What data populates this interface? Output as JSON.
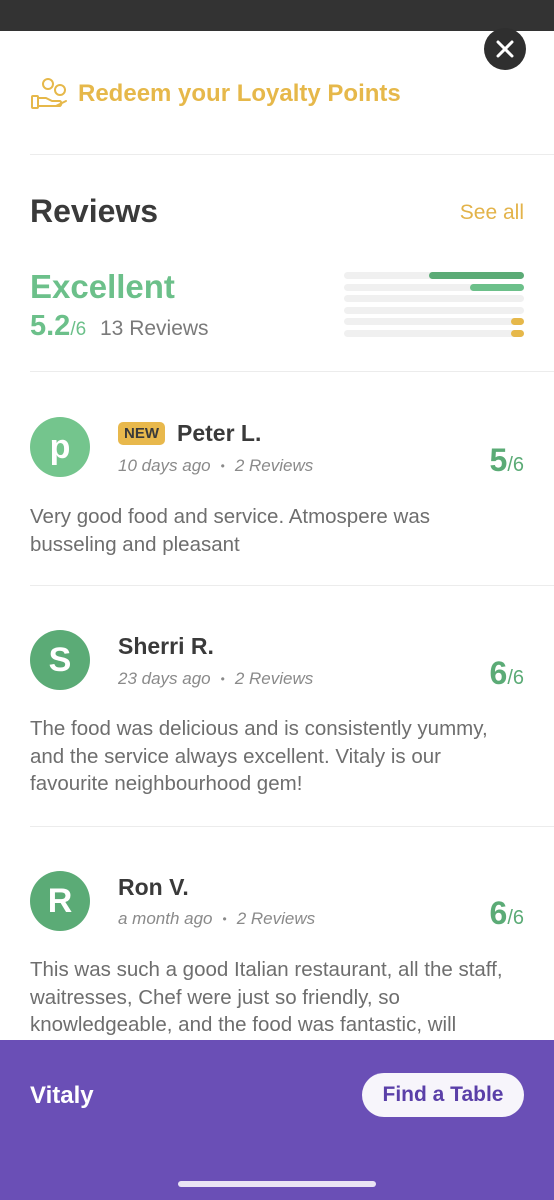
{
  "loyalty": {
    "label": "Redeem your Loyalty Points"
  },
  "reviews": {
    "title": "Reviews",
    "see_all": "See all",
    "summary": {
      "rating_word": "Excellent",
      "score": "5.2",
      "score_max": "/6",
      "count_text": "13 Reviews",
      "distribution": [
        {
          "fraction": 0.53,
          "color": "#5bab76"
        },
        {
          "fraction": 0.3,
          "color": "#6cc08a"
        },
        {
          "fraction": 0.0,
          "color": "#e6b84a"
        },
        {
          "fraction": 0.0,
          "color": "#e6b84a"
        },
        {
          "fraction": 0.07,
          "color": "#e6b84a"
        },
        {
          "fraction": 0.07,
          "color": "#e6b84a"
        }
      ]
    },
    "items": [
      {
        "initial": "p",
        "avatar_color": "#74c58d",
        "badge": "NEW",
        "name": "Peter L.",
        "date": "10 days ago",
        "review_count": "2 Reviews",
        "score": "5",
        "score_max": "/6",
        "text": "Very good food and service. Atmospere was busseling and pleasant"
      },
      {
        "initial": "S",
        "avatar_color": "#5bab76",
        "badge": "",
        "name": "Sherri R.",
        "date": "23 days ago",
        "review_count": "2 Reviews",
        "score": "6",
        "score_max": "/6",
        "text": "The food was delicious and is consistently yummy, and the service always excellent. Vitaly is our favourite neighbourhood gem!"
      },
      {
        "initial": "R",
        "avatar_color": "#5bab76",
        "badge": "",
        "name": "Ron V.",
        "date": "a month ago",
        "review_count": "2 Reviews",
        "score": "6",
        "score_max": "/6",
        "text": "This was such a good Italian restaurant, all the staff, waitresses, Chef were just so friendly, so knowledgeable, and the food was fantastic, will"
      }
    ]
  },
  "bottom_bar": {
    "restaurant_name": "Vitaly",
    "cta_label": "Find a Table"
  },
  "icons": {
    "close": "close-icon",
    "loyalty": "hand-coins-icon"
  }
}
